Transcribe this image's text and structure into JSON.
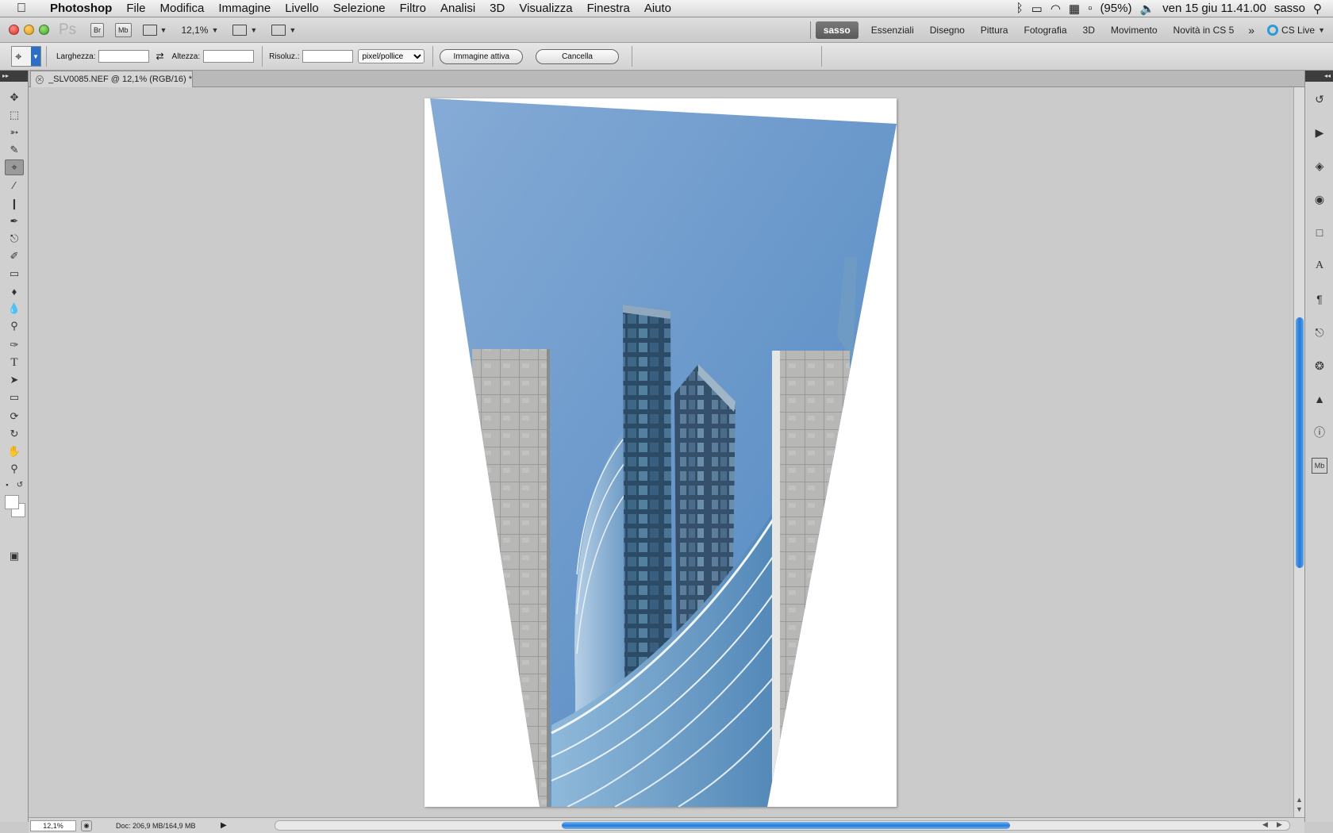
{
  "menubar": {
    "app": "Photoshop",
    "items": [
      "File",
      "Modifica",
      "Immagine",
      "Livello",
      "Selezione",
      "Filtro",
      "Analisi",
      "3D",
      "Visualizza",
      "Finestra",
      "Aiuto"
    ],
    "battery": "(95%)",
    "clock": "ven 15 giu  11.41.00",
    "user": "sasso"
  },
  "appbar": {
    "logo": "Ps",
    "bridge": "Br",
    "mini_bridge": "Mb",
    "zoom": "12,1%",
    "workspace_active": "sasso",
    "workspaces": [
      "Essenziali",
      "Disegno",
      "Pittura",
      "Fotografia",
      "3D",
      "Movimento",
      "Novità in CS 5"
    ],
    "cs_live": "CS Live"
  },
  "options": {
    "width_label": "Larghezza:",
    "width_value": "",
    "height_label": "Altezza:",
    "height_value": "",
    "resolution_label": "Risoluz.:",
    "resolution_value": "",
    "unit": "pixel/pollice",
    "front_image": "Immagine attiva",
    "clear": "Cancella"
  },
  "document": {
    "tab_title": "_SLV0085.NEF @ 12,1% (RGB/16) *"
  },
  "status": {
    "zoom": "12,1%",
    "doc_info": "Doc: 206,9 MB/164,9 MB"
  },
  "colors": {
    "accent": "#2c79d8",
    "sky": "#6a9bd0",
    "stone": "#b4b4b4"
  },
  "icons": {
    "tools": [
      "move-icon",
      "marquee-icon",
      "lasso-icon",
      "quick-select-icon",
      "crop-icon",
      "eyedropper-icon",
      "healing-icon",
      "brush-icon",
      "stamp-icon",
      "history-brush-icon",
      "eraser-icon",
      "bucket-icon",
      "blur-icon",
      "dodge-icon",
      "pen-icon",
      "type-icon",
      "path-select-icon",
      "rectangle-icon",
      "3d-rotate-icon",
      "3d-orbit-icon",
      "hand-icon",
      "zoom-icon"
    ],
    "panels": [
      "history-panel-icon",
      "actions-panel-icon",
      "layers-panel-icon",
      "channels-panel-icon",
      "paths-panel-icon",
      "character-panel-icon",
      "paragraph-panel-icon",
      "clone-source-panel-icon",
      "brushes-panel-icon",
      "histogram-panel-icon",
      "info-panel-icon",
      "mini-bridge-panel-icon"
    ]
  }
}
